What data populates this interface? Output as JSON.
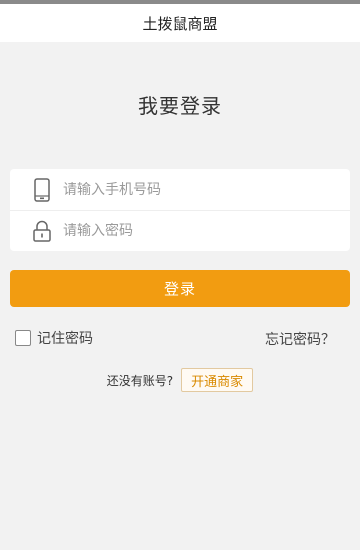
{
  "navbar": {
    "title": "土拨鼠商盟"
  },
  "page": {
    "heading": "我要登录"
  },
  "form": {
    "phone_placeholder": "请输入手机号码",
    "phone_value": "",
    "password_placeholder": "请输入密码",
    "password_value": "",
    "phone_icon": "phone-icon",
    "lock_icon": "lock-icon"
  },
  "actions": {
    "login_label": "登录",
    "remember_label": "记住密码",
    "remember_checked": false,
    "forgot_label": "忘记密码？"
  },
  "register": {
    "prompt": "还没有账号?",
    "open_label": "开通商家"
  },
  "colors": {
    "accent": "#f29c11",
    "background": "#f2f2f2",
    "open_button_text": "#d98a00"
  }
}
